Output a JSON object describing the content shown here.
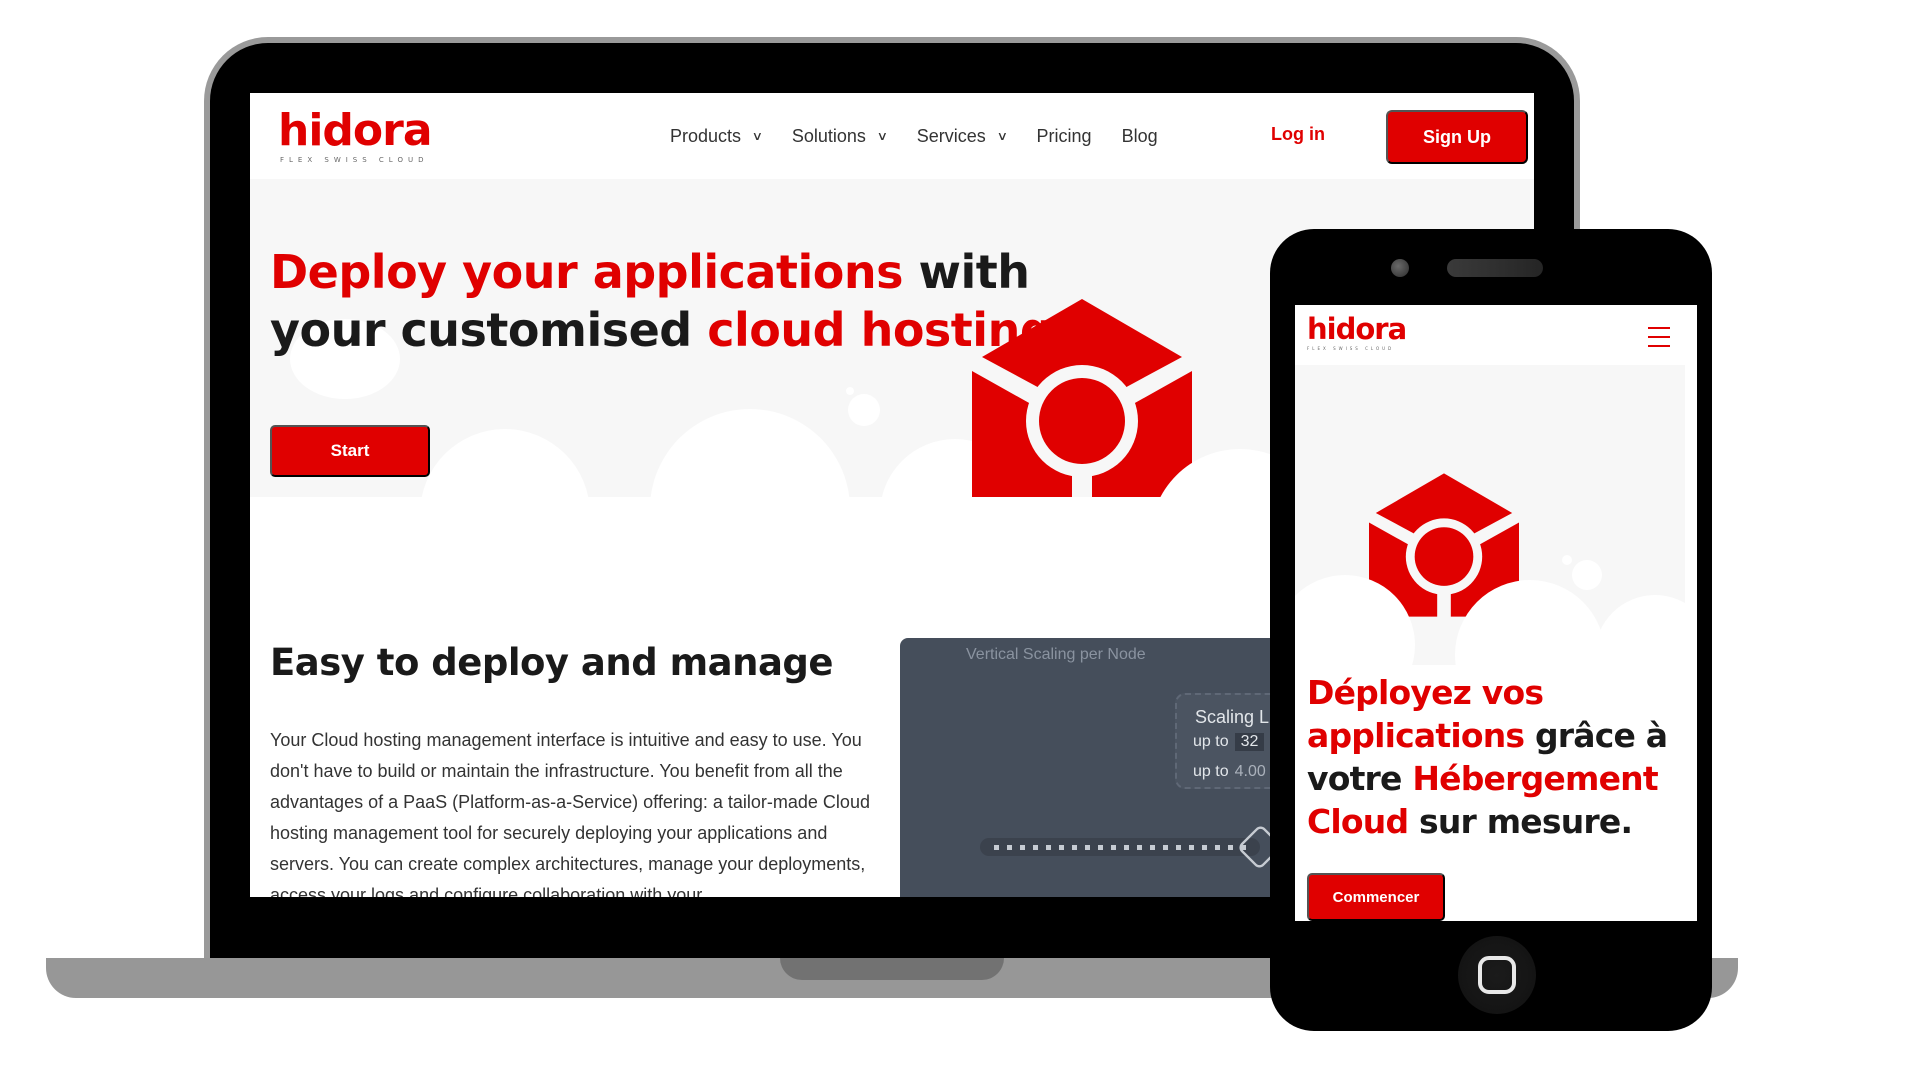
{
  "brand": {
    "name": "hidora",
    "tagline": "FLEX SWISS CLOUD",
    "accent_color": "#e00000",
    "text_color": "#1a1a1a"
  },
  "laptop": {
    "nav": {
      "items": [
        {
          "label": "Products",
          "has_dropdown": true
        },
        {
          "label": "Solutions",
          "has_dropdown": true
        },
        {
          "label": "Services",
          "has_dropdown": true
        },
        {
          "label": "Pricing",
          "has_dropdown": false
        },
        {
          "label": "Blog",
          "has_dropdown": false
        }
      ],
      "dropdown_icon": "chevron-down-icon",
      "login_label": "Log in",
      "signup_label": "Sign Up"
    },
    "hero": {
      "title_parts": [
        {
          "text": "Deploy your applications",
          "accent": true
        },
        {
          "text": " with",
          "accent": false
        },
        {
          "text": "your customised ",
          "accent": false
        },
        {
          "text": "cloud hosting.",
          "accent": true
        }
      ],
      "start_label": "Start"
    },
    "feature": {
      "title": "Easy to deploy and manage",
      "body": "Your Cloud hosting management interface is intuitive and easy to use. You don't have to build or maintain the infrastructure. You benefit from all the advantages of a PaaS (Platform-as-a-Service) offering: a tailor-made Cloud hosting management tool for securely deploying your applications and servers. You can create complex architectures, manage your deployments, access your logs and configure collaboration with your"
    },
    "preview": {
      "title": "Vertical Scaling per Node",
      "box_title": "Scaling L",
      "line1_label": "up to",
      "line1_value": "32",
      "line2_label": "up to",
      "line2_value": "4.00"
    }
  },
  "phone": {
    "menu_icon": "hamburger-icon",
    "hero": {
      "title_parts": [
        {
          "text": "Déployez vos",
          "accent": true
        },
        {
          "text": "applications",
          "accent": true
        },
        {
          "text": " grâce à",
          "accent": false
        },
        {
          "text": "votre ",
          "accent": false
        },
        {
          "text": "Hébergement",
          "accent": true
        },
        {
          "text": "Cloud",
          "accent": true
        },
        {
          "text": " sur mesure.",
          "accent": false
        }
      ],
      "cta_label": "Commencer"
    }
  }
}
